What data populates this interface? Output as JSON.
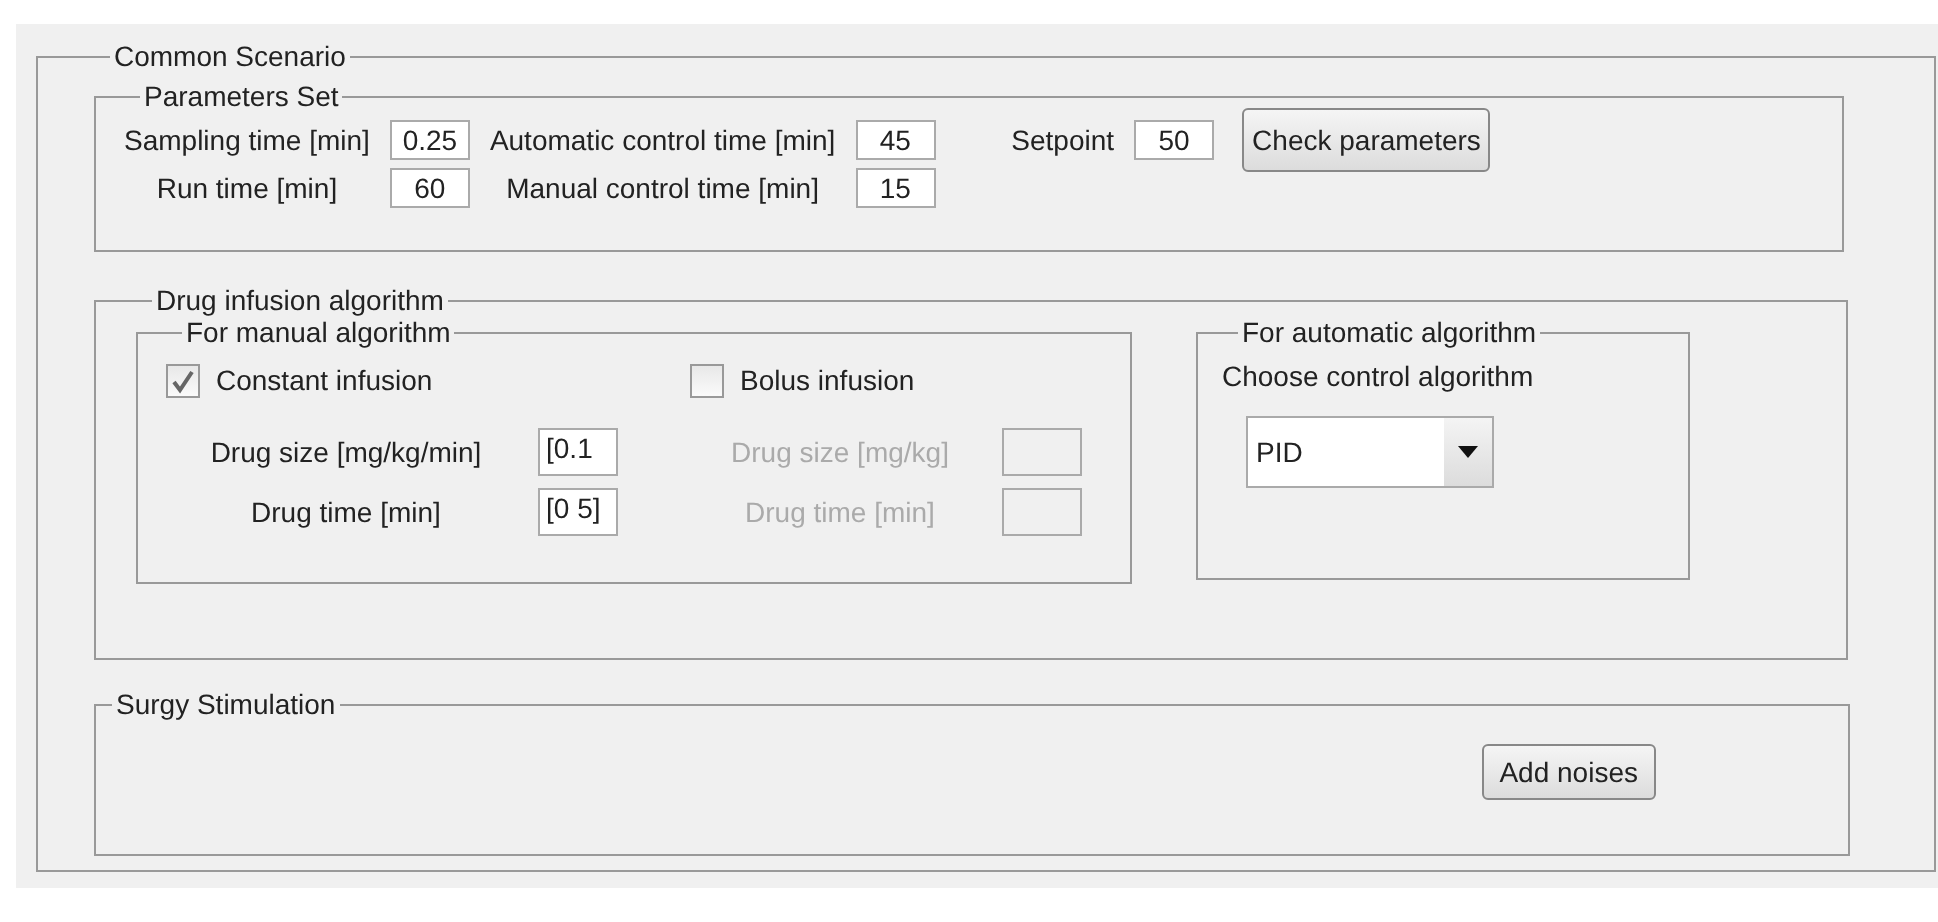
{
  "title": "Common Scenario",
  "parameters": {
    "title": "Parameters Set",
    "rows": [
      [
        {
          "label": "Sampling time [min]",
          "value": "0.25"
        },
        {
          "label": "Automatic control time [min]",
          "value": "45"
        },
        {
          "label": "Setpoint",
          "value": "50"
        }
      ],
      [
        {
          "label": "Run time [min]",
          "value": "60"
        },
        {
          "label": "Manual control time [min]",
          "value": "15"
        }
      ]
    ],
    "button": "Check parameters"
  },
  "drug": {
    "title": "Drug infusion algorithm",
    "manual": {
      "title": "For manual algorithm",
      "columns": [
        {
          "checkbox": {
            "label": "Constant infusion",
            "checked": true
          },
          "fields": [
            {
              "label": "Drug size [mg/kg/min]",
              "value": "[0.1",
              "disabled": false
            },
            {
              "label": "Drug time [min]",
              "value": "[0 5]",
              "disabled": false
            }
          ]
        },
        {
          "checkbox": {
            "label": "Bolus infusion",
            "checked": false
          },
          "fields": [
            {
              "label": "Drug size [mg/kg]",
              "disabled": true
            },
            {
              "label": "Drug time [min]",
              "disabled": true
            }
          ]
        }
      ]
    },
    "automatic": {
      "title": "For automatic algorithm",
      "label": "Choose control algorithm",
      "select": "PID"
    }
  },
  "surgery": {
    "title": "Surgy Stimulation",
    "button": "Add noises"
  }
}
